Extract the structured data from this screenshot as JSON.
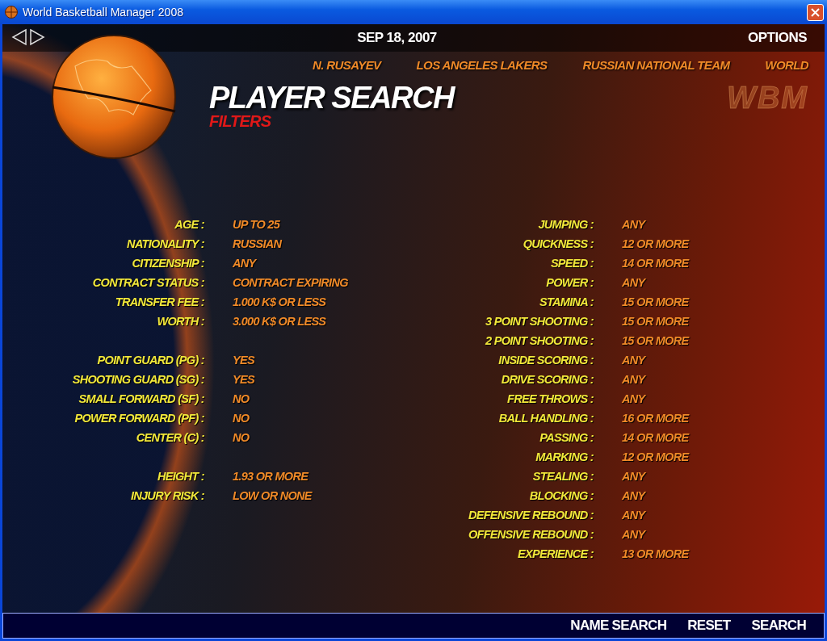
{
  "window": {
    "title": "World Basketball Manager 2008"
  },
  "top_bar": {
    "date": "SEP 18, 2007",
    "options": "OPTIONS"
  },
  "breadcrumbs": [
    {
      "label": "N. RUSAYEV"
    },
    {
      "label": "LOS ANGELES LAKERS"
    },
    {
      "label": "RUSSIAN NATIONAL TEAM"
    },
    {
      "label": "WORLD"
    }
  ],
  "logo_text": "WBM",
  "heading": {
    "title": "PLAYER SEARCH",
    "subtitle": "FILTERS"
  },
  "left_groups": [
    [
      {
        "label": "AGE :",
        "value": "UP TO 25"
      },
      {
        "label": "NATIONALITY :",
        "value": "RUSSIAN"
      },
      {
        "label": "CITIZENSHIP :",
        "value": "ANY"
      },
      {
        "label": "CONTRACT STATUS :",
        "value": "CONTRACT EXPIRING"
      },
      {
        "label": "TRANSFER FEE :",
        "value": "1.000 K$ OR LESS"
      },
      {
        "label": "WORTH :",
        "value": "3.000 K$ OR LESS"
      }
    ],
    [
      {
        "label": "POINT GUARD (PG) :",
        "value": "YES"
      },
      {
        "label": "SHOOTING GUARD (SG) :",
        "value": "YES"
      },
      {
        "label": "SMALL FORWARD (SF) :",
        "value": "NO"
      },
      {
        "label": "POWER FORWARD (PF) :",
        "value": "NO"
      },
      {
        "label": "CENTER (C) :",
        "value": "NO"
      }
    ],
    [
      {
        "label": "HEIGHT :",
        "value": "1.93 OR MORE"
      },
      {
        "label": "INJURY RISK :",
        "value": "LOW OR NONE"
      }
    ]
  ],
  "right_filters": [
    {
      "label": "JUMPING :",
      "value": "ANY"
    },
    {
      "label": "QUICKNESS :",
      "value": "12 OR MORE"
    },
    {
      "label": "SPEED :",
      "value": "14 OR MORE"
    },
    {
      "label": "POWER :",
      "value": "ANY"
    },
    {
      "label": "STAMINA :",
      "value": "15 OR MORE"
    },
    {
      "label": "3 POINT SHOOTING :",
      "value": "15 OR MORE"
    },
    {
      "label": "2 POINT SHOOTING :",
      "value": "15 OR MORE"
    },
    {
      "label": "INSIDE SCORING :",
      "value": "ANY"
    },
    {
      "label": "DRIVE SCORING :",
      "value": "ANY"
    },
    {
      "label": "FREE THROWS :",
      "value": "ANY"
    },
    {
      "label": "BALL HANDLING :",
      "value": "16 OR MORE"
    },
    {
      "label": "PASSING :",
      "value": "14 OR MORE"
    },
    {
      "label": "MARKING :",
      "value": "12 OR MORE"
    },
    {
      "label": "STEALING :",
      "value": "ANY"
    },
    {
      "label": "BLOCKING :",
      "value": "ANY"
    },
    {
      "label": "DEFENSIVE REBOUND :",
      "value": "ANY"
    },
    {
      "label": "OFFENSIVE REBOUND :",
      "value": "ANY"
    },
    {
      "label": "EXPERIENCE :",
      "value": "13 OR MORE"
    }
  ],
  "bottom_buttons": [
    "NAME SEARCH",
    "RESET",
    "SEARCH"
  ]
}
